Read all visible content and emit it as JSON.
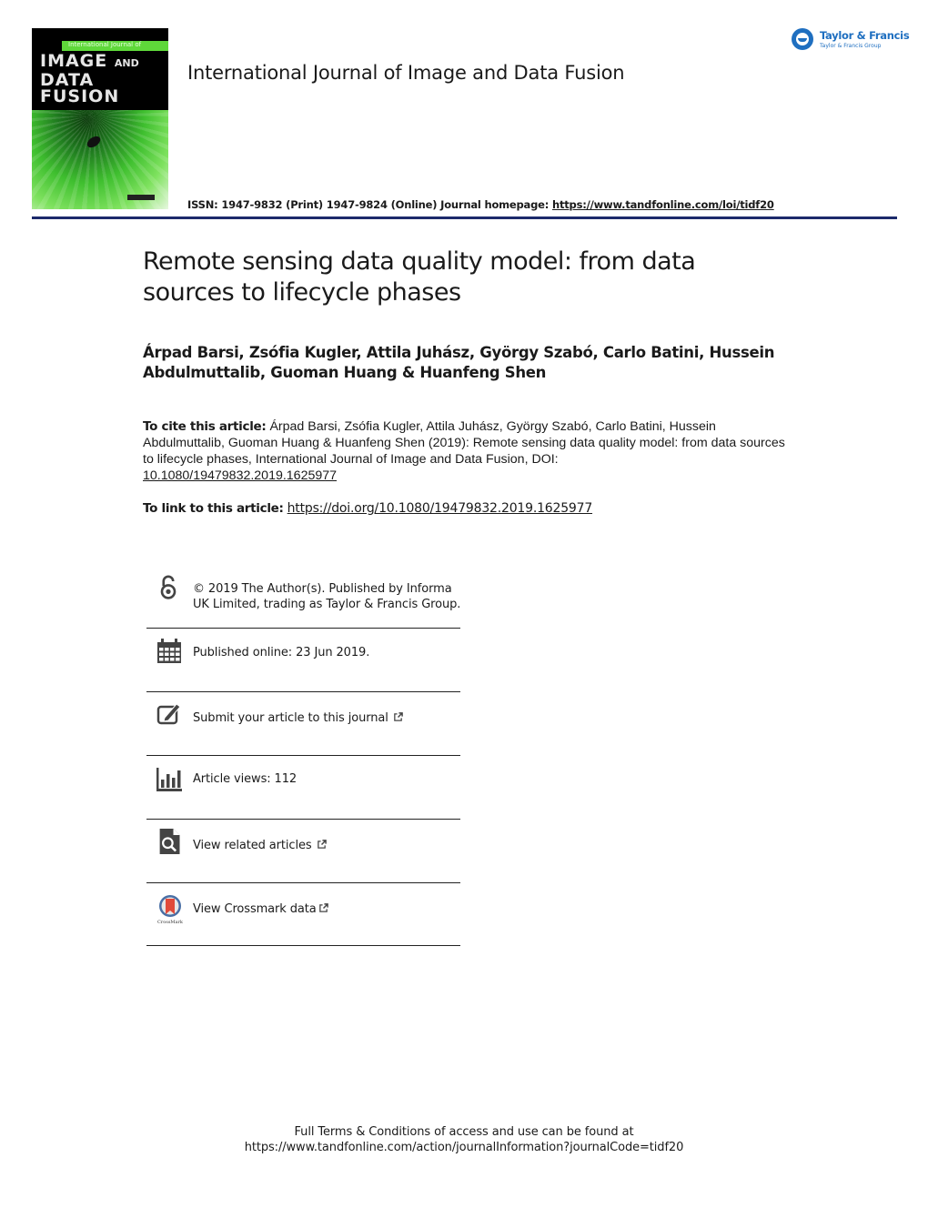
{
  "header": {
    "cover": {
      "band_text": "International Journal of",
      "title_line1": "IMAGE",
      "title_and": "AND",
      "title_line2": "DATA",
      "title_line3": "FUSION"
    },
    "journal_title": "International Journal of Image and Data Fusion",
    "issn_text": "ISSN: 1947-9832 (Print) 1947-9824 (Online) Journal homepage: ",
    "homepage_url": "https://www.tandfonline.com/loi/tidf20",
    "publisher_logo": {
      "name": "Taylor & Francis",
      "group": "Taylor & Francis Group"
    },
    "rule_color": "#1c2a6b"
  },
  "article": {
    "title": "Remote sensing data quality model: from data sources to lifecycle phases",
    "authors": "Árpad Barsi, Zsófia Kugler, Attila Juhász, György Szabó, Carlo Batini, Hussein Abdulmuttalib, Guoman Huang & Huanfeng Shen"
  },
  "citation": {
    "cite_label": "To cite this article:",
    "cite_text": " Árpad Barsi, Zsófia Kugler, Attila Juhász, György Szabó, Carlo Batini, Hussein Abdulmuttalib, Guoman Huang & Huanfeng Shen (2019): Remote sensing data quality model: from data sources to lifecycle phases, International Journal of Image and Data Fusion, DOI: ",
    "cite_doi": "10.1080/19479832.2019.1625977",
    "link_label": "To link to this article:",
    "link_url": "https://doi.org/10.1080/19479832.2019.1625977"
  },
  "info_items": [
    {
      "icon": "open-access-icon",
      "text": "© 2019 The Author(s). Published by Informa UK Limited, trading as Taylor & Francis Group."
    },
    {
      "icon": "calendar-icon",
      "text": "Published online: 23 Jun 2019."
    },
    {
      "icon": "edit-icon",
      "text": "Submit your article to this journal"
    },
    {
      "icon": "bar-chart-icon",
      "text": "Article views: 112"
    },
    {
      "icon": "search-document-icon",
      "text": "View related articles"
    },
    {
      "icon": "crossmark-icon",
      "text": "View Crossmark data",
      "sublabel": "CrossMark"
    }
  ],
  "footer": {
    "line1": "Full Terms & Conditions of access and use can be found at",
    "line2": "https://www.tandfonline.com/action/journalInformation?journalCode=tidf20"
  }
}
